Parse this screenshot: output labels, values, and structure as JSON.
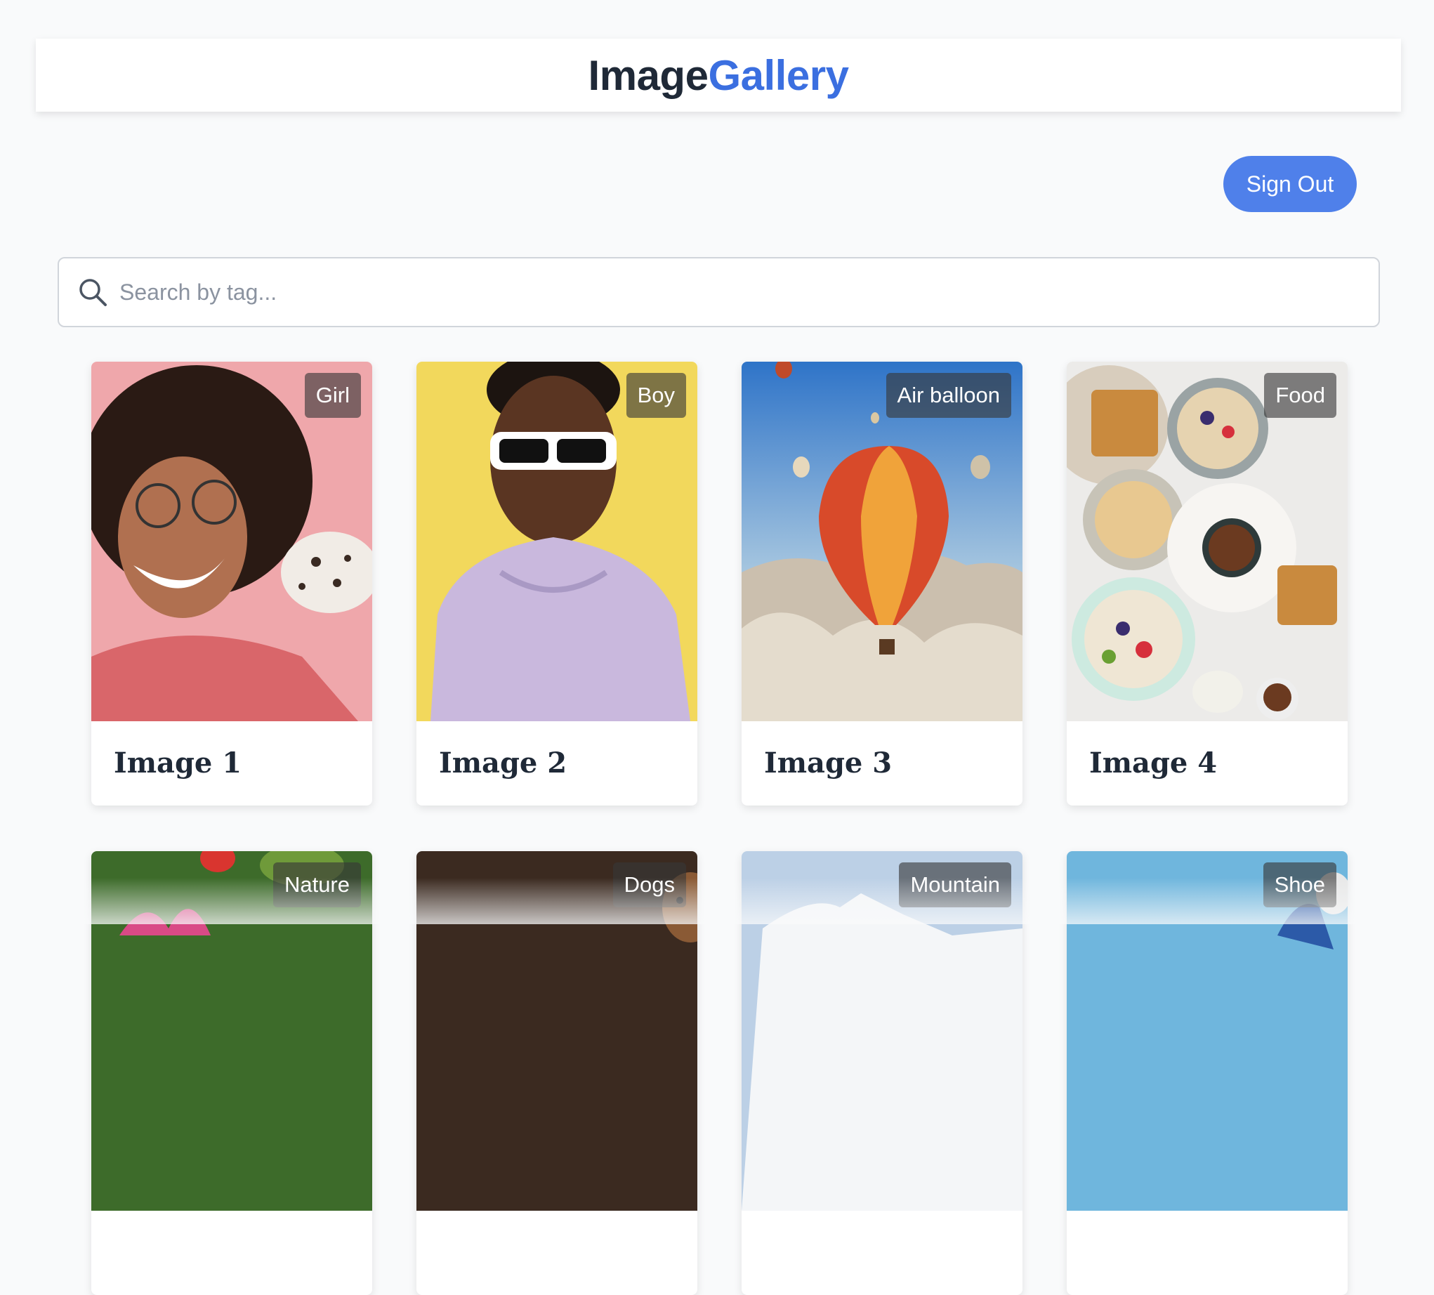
{
  "header": {
    "brand_part1": "Image",
    "brand_part2": "Gallery"
  },
  "auth": {
    "sign_out_label": "Sign Out"
  },
  "search": {
    "placeholder": "Search by tag...",
    "value": ""
  },
  "cards": [
    {
      "title": "Image 1",
      "tag": "Girl"
    },
    {
      "title": "Image 2",
      "tag": "Boy"
    },
    {
      "title": "Image 3",
      "tag": "Air balloon"
    },
    {
      "title": "Image 4",
      "tag": "Food"
    },
    {
      "title": "",
      "tag": "Nature"
    },
    {
      "title": "",
      "tag": "Dogs"
    },
    {
      "title": "",
      "tag": "Mountain"
    },
    {
      "title": "",
      "tag": "Shoe"
    }
  ],
  "colors": {
    "brand_accent": "#3b6fe0",
    "button": "#4f80ea"
  }
}
